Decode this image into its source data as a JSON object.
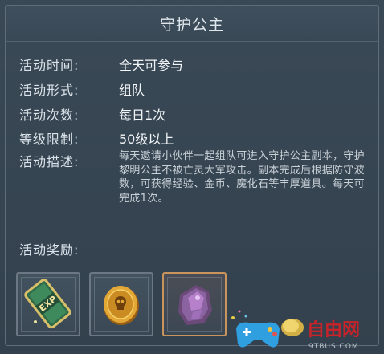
{
  "title": "守护公主",
  "info": [
    {
      "label": "活动时间:",
      "value": "全天可参与"
    },
    {
      "label": "活动形式:",
      "value": "组队"
    },
    {
      "label": "活动次数:",
      "value": "每日1次"
    },
    {
      "label": "等级限制:",
      "value": "50级以上"
    }
  ],
  "description": {
    "label": "活动描述:",
    "text": "每天邀请小伙伴一起组队可进入守护公主副本，守护黎明公主不被亡灵大军攻击。副本完成后根据防守波数，可获得经验、金币、魔化石等丰厚道具。每天可完成1次。"
  },
  "rewards": {
    "label": "活动奖励:",
    "items": [
      {
        "icon": "exp-card-icon",
        "text": "EXP"
      },
      {
        "icon": "gold-coin-icon"
      },
      {
        "icon": "magic-stone-icon"
      }
    ]
  },
  "watermark": {
    "site": "9TBUS.COM",
    "brand": "自由网"
  }
}
